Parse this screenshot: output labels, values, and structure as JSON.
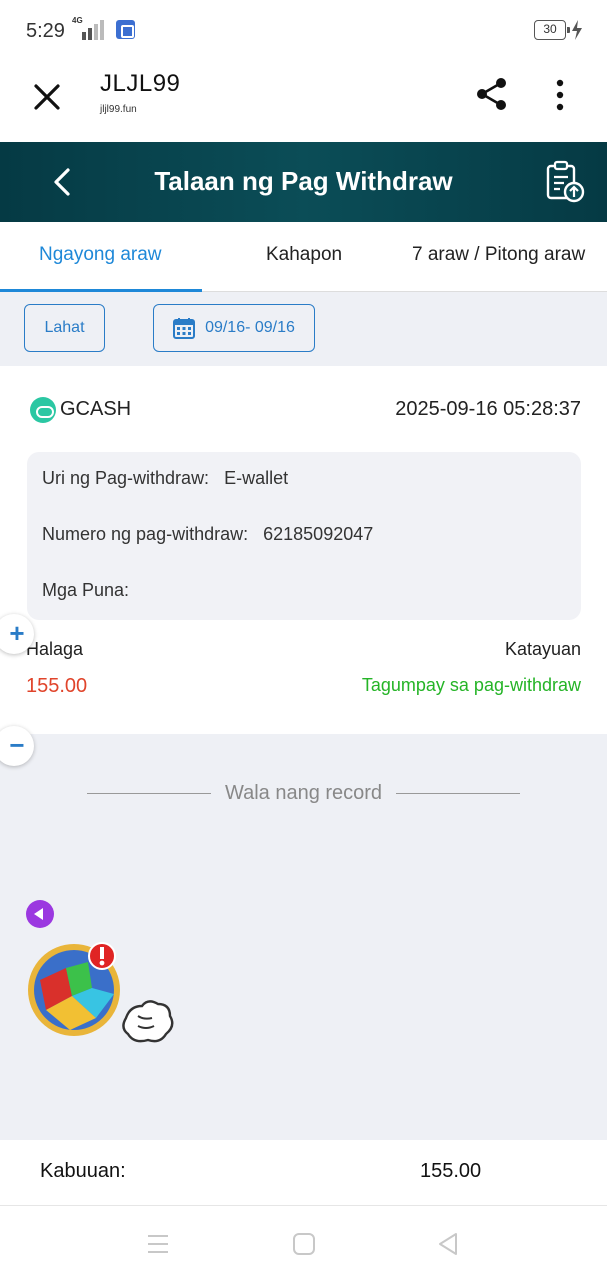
{
  "status_bar": {
    "time": "5:29",
    "network": "4G",
    "battery": "30"
  },
  "browser": {
    "title": "JLJL99",
    "url": "jljl99.fun"
  },
  "header": {
    "title": "Talaan ng Pag Withdraw"
  },
  "tabs": [
    {
      "label": "Ngayong araw",
      "active": true
    },
    {
      "label": "Kahapon",
      "active": false
    },
    {
      "label": "7 araw / Pitong araw",
      "active": false
    }
  ],
  "filters": {
    "all_label": "Lahat",
    "date_range": "09/16- 09/16"
  },
  "record": {
    "method": "GCASH",
    "datetime": "2025-09-16 05:28:37",
    "type_label": "Uri ng Pag-withdraw:",
    "type_value": "E-wallet",
    "number_label": "Numero ng pag-withdraw:",
    "number_value": "62185092047",
    "remarks_label": "Mga Puna:",
    "remarks_value": "",
    "amount_label": "Halaga",
    "amount_value": "155.00",
    "status_label": "Katayuan",
    "status_value": "Tagumpay sa pag-withdraw"
  },
  "empty_message": "Wala nang record",
  "side_buttons": {
    "plus": "+",
    "minus": "−"
  },
  "total": {
    "label": "Kabuuan:",
    "value": "155.00"
  },
  "colors": {
    "accent": "#1e88d8",
    "header_bg": "#0b4d57",
    "amount": "#e0442b",
    "success": "#25b427",
    "gcash": "#2bc7a3"
  }
}
